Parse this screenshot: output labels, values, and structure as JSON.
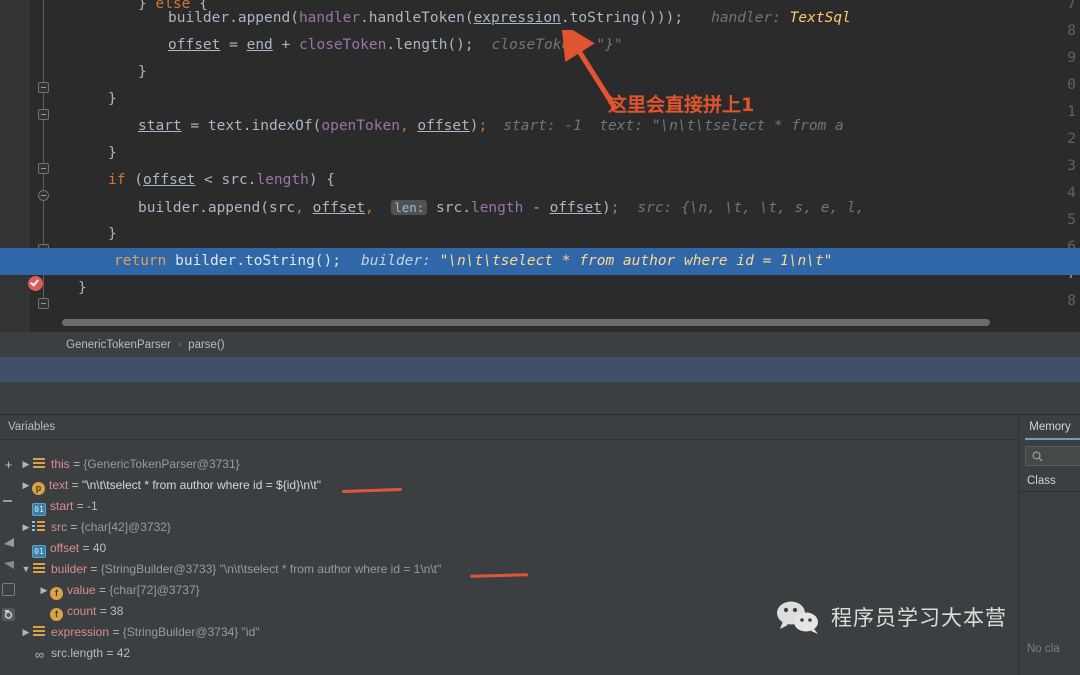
{
  "editor": {
    "lines": [
      {
        "n": "7",
        "text": "} else {"
      },
      {
        "n": "8",
        "text": "builder.append(handler.handleToken(expression.toString()));",
        "hint": "handler:",
        "hint_value": "TextSql"
      },
      {
        "n": "9",
        "text": "offset = end + closeToken.length();",
        "hint": "closeToken: \"}\""
      },
      {
        "n": "0",
        "text": "}"
      },
      {
        "n": "1",
        "text": "}"
      },
      {
        "n": "2",
        "text": "start = text.indexOf(openToken, offset);",
        "hint": "start: -1   text: \"\\n\\t\\tselect * from a"
      },
      {
        "n": "3",
        "text": "}"
      },
      {
        "n": "4",
        "text": "if (offset < src.length) {"
      },
      {
        "n": "5",
        "text": "builder.append(src, offset,  len: src.length - offset);",
        "hint": "src: {\\n, \\t, \\t, s, e, l,"
      },
      {
        "n": "6",
        "text": "}"
      },
      {
        "n": "7",
        "text": "return builder.toString();",
        "hint": "builder: \"\\n\\t\\tselect * from author where id = 1\\n\\t\""
      },
      {
        "n": "8",
        "text": "}"
      }
    ],
    "tokens": {
      "else": "else",
      "builder_append": "builder.append(",
      "handler": "handler",
      "handle_token": ".handleToken(",
      "expression": "expression",
      "to_string_close": ".toString()));",
      "offset": "offset",
      "eq": " = ",
      "end": "end",
      "plus": " + ",
      "close_token": "closeToken",
      "length_call": ".length();",
      "close_token_hint": "closeToken: \"}\"",
      "handler_hint": "handler:",
      "handler_hint_value": "TextSql",
      "brace_close": "}",
      "start": "start",
      "text_index_of": "text.indexOf(",
      "open_token": "openToken",
      "comma": ", ",
      "paren_semi": ");",
      "start_hint": "start: -1",
      "text_hint": "text: \"\\n\\t\\tselect * from a",
      "if": "if",
      "src_length": "src.length",
      "lt": " < ",
      "brace_open": ") {",
      "if_open": " (",
      "builder_append2": "builder.append(src, offset,",
      "len_label": "len:",
      "src_len_minus": "src.length",
      "minus": " - ",
      "src_hint": "src: {\\n, \\t, \\t, s, e, l,",
      "return": "return",
      "builder_to_string": "builder.toString();",
      "builder_hint_label": "builder:",
      "builder_hint_value": "\"\\n\\t\\tselect * from author where id = 1\\n\\t\""
    }
  },
  "annotation": {
    "text": "这里会直接拼上1",
    "color": "#e0542f"
  },
  "breadcrumb": {
    "class_name": "GenericTokenParser",
    "separator": "›",
    "method_name": "parse()"
  },
  "variables_panel": {
    "title": "Variables",
    "rows": [
      {
        "indent": 0,
        "arrow": "▶",
        "icon": "object-icon",
        "name": "this",
        "eq": " = ",
        "value": "{GenericTokenParser@3731}"
      },
      {
        "indent": 0,
        "arrow": "▶",
        "icon": "parameter-icon",
        "name": "text",
        "eq": " = ",
        "value": "\"\\n\\t\\tselect * from author where id = ${id}\\n\\t\""
      },
      {
        "indent": 0,
        "arrow": "",
        "icon": "primitive-icon",
        "name": "start",
        "eq": " = ",
        "value": "-1"
      },
      {
        "indent": 0,
        "arrow": "▶",
        "icon": "array-icon",
        "name": "src",
        "eq": " = ",
        "value": "{char[42]@3732}"
      },
      {
        "indent": 0,
        "arrow": "",
        "icon": "primitive-icon",
        "name": "offset",
        "eq": " = ",
        "value": "40"
      },
      {
        "indent": 0,
        "arrow": "▼",
        "icon": "object-icon",
        "name": "builder",
        "eq": " = ",
        "value": "{StringBuilder@3733} \"\\n\\t\\tselect * from author where id = 1\\n\\t\""
      },
      {
        "indent": 1,
        "arrow": "▶",
        "icon": "field-icon",
        "name": "value",
        "eq": " = ",
        "value": "{char[72]@3737}"
      },
      {
        "indent": 1,
        "arrow": "",
        "icon": "field-icon",
        "name": "count",
        "eq": " = ",
        "value": "38"
      },
      {
        "indent": 0,
        "arrow": "▶",
        "icon": "object-icon",
        "name": "expression",
        "eq": " = ",
        "value": "{StringBuilder@3734} \"id\""
      },
      {
        "indent": 0,
        "arrow": "",
        "icon": "watch-icon",
        "name": "src.length",
        "eq": " = ",
        "value": "42"
      }
    ]
  },
  "memory_panel": {
    "tab_label": "Memory",
    "search_placeholder": "",
    "column_header": "Class",
    "empty_text": "No cla"
  },
  "watermark": {
    "text": "程序员学习大本营"
  },
  "colors": {
    "editor_bg": "#2b2b2b",
    "panel_bg": "#3c3f41",
    "highlight": "#2f67a8",
    "accent_red": "#e0542f",
    "keyword": "#cc7832",
    "string": "#6a8759",
    "field": "#9876aa"
  }
}
